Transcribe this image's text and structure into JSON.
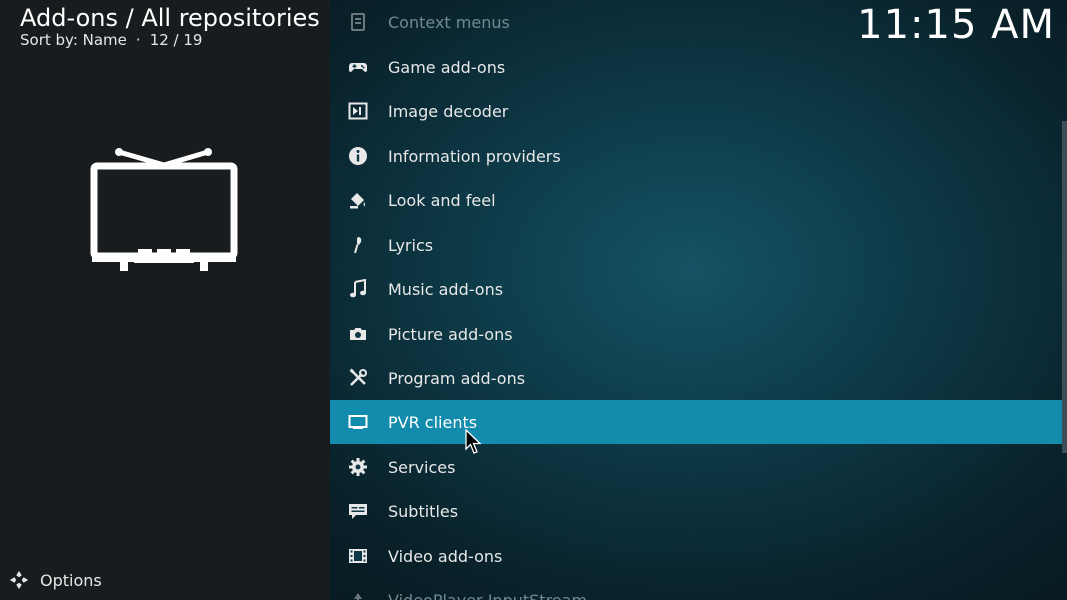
{
  "header": {
    "title": "Add-ons / All repositories",
    "sort_label": "Sort by: Name",
    "separator": "·",
    "position": "12 / 19"
  },
  "clock": "11:15 AM",
  "options": {
    "label": "Options",
    "icon": "options-icon"
  },
  "preview_icon": "tv-icon",
  "list": {
    "items": [
      {
        "label": "Context menus",
        "icon": "context-menu-icon",
        "state": "faded"
      },
      {
        "label": "Game add-ons",
        "icon": "gamepad-icon",
        "state": "normal"
      },
      {
        "label": "Image decoder",
        "icon": "image-decoder-icon",
        "state": "normal"
      },
      {
        "label": "Information providers",
        "icon": "info-icon",
        "state": "normal"
      },
      {
        "label": "Look and feel",
        "icon": "paint-bucket-icon",
        "state": "normal"
      },
      {
        "label": "Lyrics",
        "icon": "microphone-icon",
        "state": "normal"
      },
      {
        "label": "Music add-ons",
        "icon": "music-note-icon",
        "state": "normal"
      },
      {
        "label": "Picture add-ons",
        "icon": "camera-icon",
        "state": "normal"
      },
      {
        "label": "Program add-ons",
        "icon": "tools-icon",
        "state": "normal"
      },
      {
        "label": "PVR clients",
        "icon": "tv-small-icon",
        "state": "selected"
      },
      {
        "label": "Services",
        "icon": "gear-icon",
        "state": "normal"
      },
      {
        "label": "Subtitles",
        "icon": "subtitles-icon",
        "state": "normal"
      },
      {
        "label": "Video add-ons",
        "icon": "film-icon",
        "state": "normal"
      },
      {
        "label": "VideoPlayer InputStream",
        "icon": "inputstream-icon",
        "state": "faded"
      }
    ]
  },
  "colors": {
    "selected_bg": "#128bad",
    "left_panel_bg": "#181c1e",
    "list_bg": "#0d3744"
  }
}
